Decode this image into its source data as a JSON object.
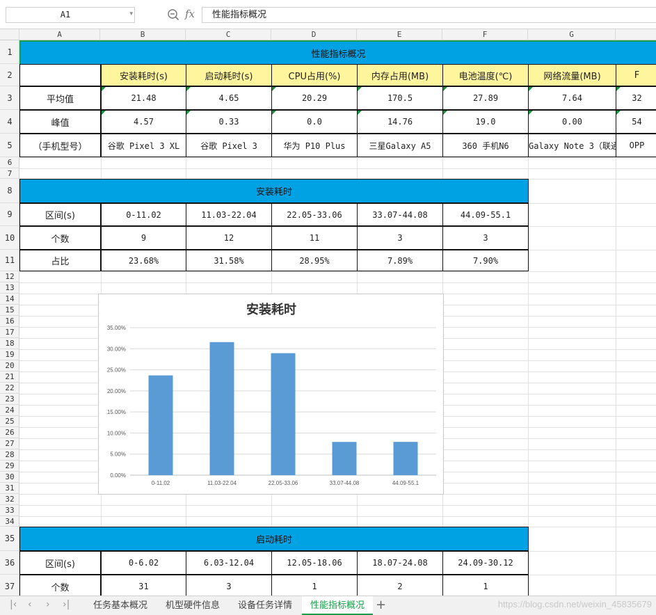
{
  "formula": {
    "cell_ref": "A1",
    "fx_label": "fx",
    "content": "性能指标概况"
  },
  "columns": [
    "A",
    "B",
    "C",
    "D",
    "E",
    "F",
    "G"
  ],
  "rows": [
    "1",
    "2",
    "3",
    "4",
    "5",
    "6",
    "7",
    "8",
    "9",
    "10",
    "11",
    "12",
    "13",
    "14",
    "15",
    "16",
    "17",
    "18",
    "19",
    "20",
    "21",
    "22",
    "23",
    "24",
    "25",
    "26",
    "27",
    "28",
    "29",
    "30",
    "31",
    "32",
    "33",
    "34",
    "35",
    "36",
    "37"
  ],
  "perf": {
    "title": "性能指标概况",
    "headers": [
      "安装耗时(s)",
      "启动耗时(s)",
      "CPU占用(%)",
      "内存占用(MB)",
      "电池温度(℃)",
      "网络流量(MB)",
      "F"
    ],
    "avg": {
      "label": "平均值",
      "values": [
        "21.48",
        "4.65",
        "20.29",
        "170.5",
        "27.89",
        "7.64",
        "32"
      ]
    },
    "peak": {
      "label": "峰值",
      "values": [
        "4.57",
        "0.33",
        "0.0",
        "14.76",
        "19.0",
        "0.00",
        "54"
      ]
    },
    "model": {
      "label": "（手机型号）",
      "values": [
        "谷歌  Pixel 3 XL",
        "谷歌 Pixel 3",
        "华为 P10 Plus",
        "三星Galaxy A5",
        "360 手机N6",
        "Galaxy Note 3（联通",
        "OPP"
      ]
    }
  },
  "install": {
    "title": "安装耗时",
    "range_label": "区间(s)",
    "count_label": "个数",
    "ratio_label": "占比",
    "ranges": [
      "0-11.02",
      "11.03-22.04",
      "22.05-33.06",
      "33.07-44.08",
      "44.09-55.1"
    ],
    "counts": [
      "9",
      "12",
      "11",
      "3",
      "3"
    ],
    "ratios": [
      "23.68%",
      "31.58%",
      "28.95%",
      "7.89%",
      "7.90%"
    ]
  },
  "startup": {
    "title": "启动耗时",
    "range_label": "区间(s)",
    "count_label": "个数",
    "ranges": [
      "0-6.02",
      "6.03-12.04",
      "12.05-18.06",
      "18.07-24.08",
      "24.09-30.12"
    ],
    "counts": [
      "31",
      "3",
      "1",
      "2",
      "1"
    ]
  },
  "chart_data": {
    "type": "bar",
    "title": "安装耗时",
    "categories": [
      "0-11.02",
      "11.03-22.04",
      "22.05-33.06",
      "33.07-44.08",
      "44.09-55.1"
    ],
    "values": [
      23.68,
      31.58,
      28.95,
      7.89,
      7.9
    ],
    "ylim": [
      0,
      35
    ],
    "yticks": [
      "0.00%",
      "5.00%",
      "10.00%",
      "15.00%",
      "20.00%",
      "25.00%",
      "30.00%",
      "35.00%"
    ],
    "xlabel": "",
    "ylabel": "",
    "grid": true,
    "bar_color": "#5b9bd5"
  },
  "sheets": {
    "tabs": [
      "任务基本概况",
      "机型硬件信息",
      "设备任务详情",
      "性能指标概况"
    ],
    "active": 3,
    "add": "+"
  },
  "watermark": "https://blog.csdn.net/weixin_45835679",
  "colors": {
    "banner": "#00a2e3",
    "header_fill": "#fff59d",
    "active_tab": "#1a9e4b"
  }
}
